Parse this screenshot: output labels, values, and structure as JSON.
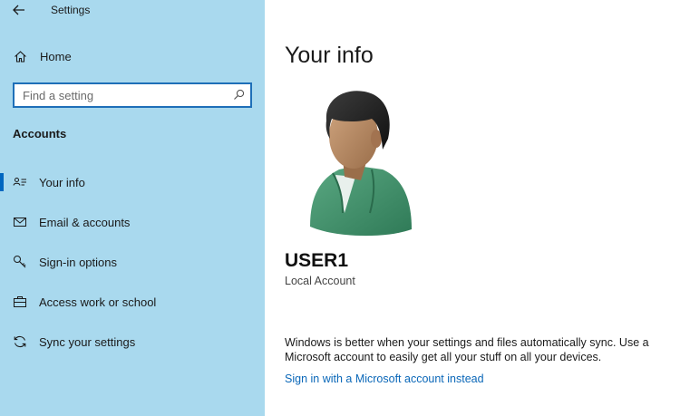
{
  "window": {
    "title": "Settings"
  },
  "sidebar": {
    "home_label": "Home",
    "search": {
      "placeholder": "Find a setting",
      "value": ""
    },
    "section_title": "Accounts",
    "items": [
      {
        "label": "Your info",
        "icon": "contact-card-icon",
        "selected": true
      },
      {
        "label": "Email & accounts",
        "icon": "mail-icon",
        "selected": false
      },
      {
        "label": "Sign-in options",
        "icon": "key-icon",
        "selected": false
      },
      {
        "label": "Access work or school",
        "icon": "briefcase-icon",
        "selected": false
      },
      {
        "label": "Sync your settings",
        "icon": "sync-icon",
        "selected": false
      }
    ]
  },
  "main": {
    "title": "Your info",
    "user_name": "USER1",
    "account_type": "Local Account",
    "sync_message": "Windows is better when your settings and files automatically sync. Use a Microsoft account to easily get all your stuff on all your devices.",
    "ms_link": "Sign in with a Microsoft account instead"
  },
  "colors": {
    "sidebar_bg": "#a9d9ee",
    "accent": "#0067c0",
    "link": "#0a67b8",
    "search_border": "#1e6fb8"
  }
}
